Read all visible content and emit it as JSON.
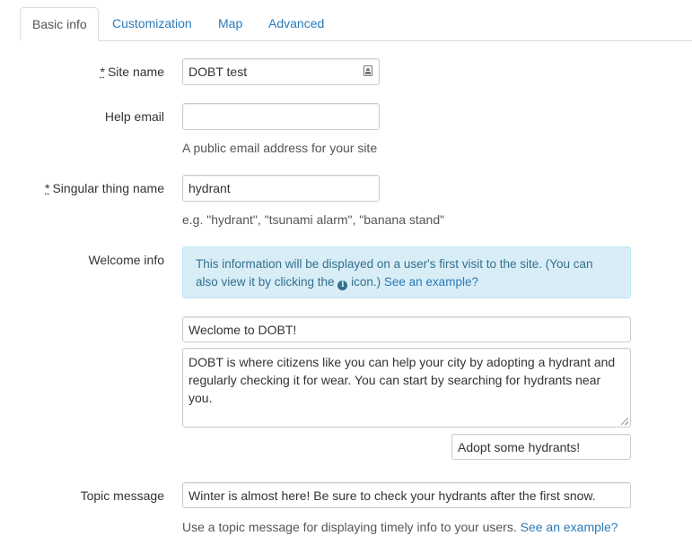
{
  "tabs": [
    {
      "label": "Basic info",
      "active": true
    },
    {
      "label": "Customization",
      "active": false
    },
    {
      "label": "Map",
      "active": false
    },
    {
      "label": "Advanced",
      "active": false
    }
  ],
  "form": {
    "required_marker": "*",
    "site_name": {
      "label": "Site name",
      "value": "DOBT test"
    },
    "help_email": {
      "label": "Help email",
      "value": "",
      "help": "A public email address for your site"
    },
    "singular_thing_name": {
      "label": "Singular thing name",
      "value": "hydrant",
      "help": "e.g. \"hydrant\", \"tsunami alarm\", \"banana stand\""
    },
    "welcome_info": {
      "label": "Welcome info",
      "info_text_1": "This information will be displayed on a user's first visit to the site. (You can also view it by clicking the",
      "info_icon_glyph": "i",
      "info_text_2": "icon.)",
      "info_link": "See an example?",
      "heading_value": "Weclome to DOBT!",
      "body_value": "DOBT is where citizens like you can help your city by adopting a hydrant and regularly checking it for wear. You can start by searching for hydrants near you.",
      "button_value": "Adopt some hydrants!"
    },
    "topic_message": {
      "label": "Topic message",
      "value": "Winter is almost here! Be sure to check your hydrants after the first snow.",
      "help": "Use a topic message for displaying timely info to your users.",
      "help_link": "See an example?"
    }
  },
  "colors": {
    "link": "#2a7ab8",
    "info_bg": "#d9edf7",
    "info_border": "#bce8f1",
    "info_text": "#31708f"
  }
}
